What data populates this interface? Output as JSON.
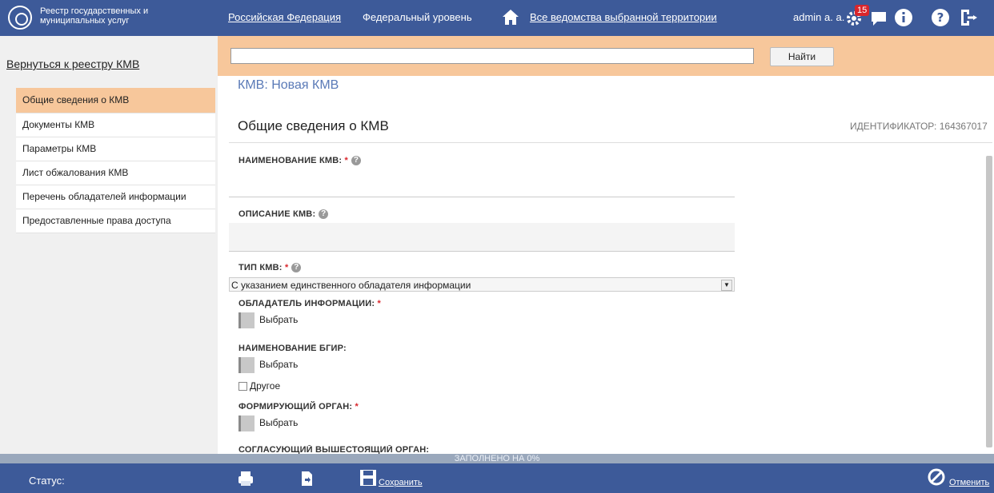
{
  "header": {
    "logo_text": "Реестр государственных и муниципальных услуг",
    "nav_territory": "Российская Федерация",
    "nav_level": "Федеральный уровень",
    "nav_departments": "Все ведомства выбранной территории",
    "user": "admin a. a.",
    "notification_count": "15"
  },
  "search": {
    "value": "",
    "button": "Найти"
  },
  "sidebar": {
    "back_link": "Вернуться к реестру КМВ",
    "items": [
      {
        "label": "Общие сведения о КМВ"
      },
      {
        "label": "Документы КМВ"
      },
      {
        "label": "Параметры КМВ"
      },
      {
        "label": "Лист обжалования КМВ"
      },
      {
        "label": "Перечень обладателей информации"
      },
      {
        "label": "Предоставленные права доступа"
      }
    ]
  },
  "page": {
    "title": "КМВ: Новая КМВ",
    "section_title": "Общие сведения о КМВ",
    "identifier": "ИДЕНТИФИКАТОР: 164367017"
  },
  "form": {
    "name_label": "НАИМЕНОВАНИЕ КМВ:",
    "description_label": "ОПИСАНИЕ КМВ:",
    "type_label": "ТИП КМВ:",
    "type_value": "С указанием единственного обладателя информации",
    "owner_label": "ОБЛАДАТЕЛЬ ИНФОРМАЦИИ:",
    "bgir_label": "НАИМЕНОВАНИЕ БГИР:",
    "forming_label": "ФОРМИРУЮЩИЙ ОРГАН:",
    "approving_label": "СОГЛАСУЮЩИЙ ВЫШЕСТОЯЩИЙ ОРГАН:",
    "choose": "Выбрать",
    "other": "Другое",
    "required_mark": "*"
  },
  "footer": {
    "progress": "ЗАПОЛНЕНО НА 0%",
    "status": "Статус:",
    "save": "Сохранить",
    "cancel": "Отменить"
  }
}
